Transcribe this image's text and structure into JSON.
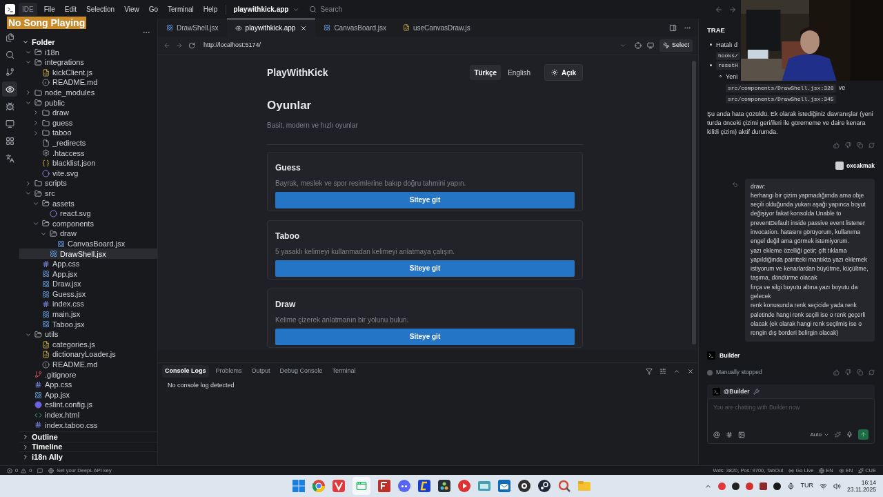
{
  "overlay": {
    "label": "No Song Playing"
  },
  "menu_bar": {
    "app_label": "IDE",
    "menus": [
      "File",
      "Edit",
      "Selection",
      "View",
      "Go",
      "Terminal",
      "Help"
    ],
    "project": "playwithkick.app",
    "search": {
      "placeholder": "Search"
    }
  },
  "activity_bar": [
    {
      "kind": "files",
      "selected": false
    },
    {
      "kind": "search",
      "selected": false
    },
    {
      "kind": "git",
      "selected": false
    },
    {
      "kind": "eye",
      "selected": true
    },
    {
      "kind": "bug",
      "selected": false
    },
    {
      "kind": "monitor",
      "selected": false
    },
    {
      "kind": "grid",
      "selected": false
    },
    {
      "kind": "translate",
      "selected": false
    }
  ],
  "explorer": {
    "section": "Folder",
    "tree": [
      {
        "name": "i18n",
        "kind": "folder",
        "expanded": true
      },
      {
        "name": "integrations",
        "kind": "folder",
        "expanded": true,
        "children": [
          {
            "name": "kickClient.js",
            "kind": "js",
            "selected": false
          },
          {
            "name": "README.md",
            "kind": "info",
            "selected": false
          }
        ]
      },
      {
        "name": "node_modules",
        "kind": "folder",
        "expanded": false
      },
      {
        "name": "public",
        "kind": "folder",
        "expanded": true,
        "children": [
          {
            "name": "draw",
            "kind": "folder",
            "expanded": false
          },
          {
            "name": "guess",
            "kind": "folder",
            "expanded": false
          },
          {
            "name": "taboo",
            "kind": "folder",
            "expanded": false
          },
          {
            "name": "_redirects",
            "kind": "file",
            "selected": false
          },
          {
            "name": ".htaccess",
            "kind": "gear",
            "selected": false
          },
          {
            "name": "blacklist.json",
            "kind": "json",
            "selected": false
          },
          {
            "name": "vite.svg",
            "kind": "svg",
            "selected": false
          }
        ]
      },
      {
        "name": "scripts",
        "kind": "folder",
        "expanded": false
      },
      {
        "name": "src",
        "kind": "folder",
        "expanded": true,
        "children": [
          {
            "name": "assets",
            "kind": "folder",
            "expanded": true,
            "children": [
              {
                "name": "react.svg",
                "kind": "svg",
                "selected": false
              }
            ]
          },
          {
            "name": "components",
            "kind": "folder",
            "expanded": true,
            "children": [
              {
                "name": "draw",
                "kind": "folder",
                "expanded": true,
                "children": [
                  {
                    "name": "CanvasBoard.jsx",
                    "kind": "react",
                    "selected": false
                  }
                ]
              },
              {
                "name": "DrawShell.jsx",
                "kind": "react",
                "selected": true
              }
            ]
          },
          {
            "name": "App.css",
            "kind": "css",
            "selected": false
          },
          {
            "name": "App.jsx",
            "kind": "react",
            "selected": false
          },
          {
            "name": "Draw.jsx",
            "kind": "react",
            "selected": false
          },
          {
            "name": "Guess.jsx",
            "kind": "react",
            "selected": false
          },
          {
            "name": "index.css",
            "kind": "css",
            "selected": false
          },
          {
            "name": "main.jsx",
            "kind": "react",
            "selected": false
          },
          {
            "name": "Taboo.jsx",
            "kind": "react",
            "selected": false
          }
        ]
      },
      {
        "name": "utils",
        "kind": "folder",
        "expanded": true,
        "children": [
          {
            "name": "categories.js",
            "kind": "js",
            "selected": false
          },
          {
            "name": "dictionaryLoader.js",
            "kind": "js",
            "selected": false
          },
          {
            "name": "README.md",
            "kind": "info",
            "selected": false
          }
        ]
      },
      {
        "name": ".gitignore",
        "kind": "git",
        "selected": false
      },
      {
        "name": "App.css",
        "kind": "css",
        "selected": false
      },
      {
        "name": "App.jsx",
        "kind": "react",
        "selected": false
      },
      {
        "name": "eslint.config.js",
        "kind": "eslint",
        "selected": false
      },
      {
        "name": "index.html",
        "kind": "html",
        "selected": false
      },
      {
        "name": "index.taboo.css",
        "kind": "css",
        "selected": false
      }
    ],
    "sections": [
      {
        "label": "Outline",
        "expanded": false
      },
      {
        "label": "Timeline",
        "expanded": false
      },
      {
        "label": "i18n Ally",
        "expanded": false
      }
    ]
  },
  "editor_tabs": [
    {
      "label": "DrawShell.jsx",
      "kind": "react",
      "selected": false
    },
    {
      "label": "playwithkick.app",
      "kind": "eye",
      "selected": true
    },
    {
      "label": "CanvasBoard.jsx",
      "kind": "react",
      "selected": false
    },
    {
      "label": "useCanvasDraw.js",
      "kind": "js",
      "selected": false
    }
  ],
  "browser": {
    "url": "http://localhost:5174/",
    "select_label": "Select"
  },
  "preview": {
    "brand": "PlayWithKick",
    "languages": [
      {
        "label": "Türkçe",
        "selected": true
      },
      {
        "label": "English",
        "selected": false
      }
    ],
    "theme_label": "Açık",
    "title": "Oyunlar",
    "subtitle": "Basit, modern ve hızlı oyunlar",
    "games": [
      {
        "title": "Guess",
        "description": "Bayrak, meslek ve spor resimlerine bakıp doğru tahmini yapın.",
        "button": "Siteye git"
      },
      {
        "title": "Taboo",
        "description": "5 yasaklı kelimeyi kullanmadan kelimeyi anlatmaya çalışın.",
        "button": "Siteye git"
      },
      {
        "title": "Draw",
        "description": "Kelime çizerek anlatmanın bir yolunu bulun.",
        "button": "Siteye git"
      }
    ]
  },
  "panel": {
    "tabs": [
      {
        "label": "Console Logs",
        "selected": true
      },
      {
        "label": "Problems",
        "selected": false
      },
      {
        "label": "Output",
        "selected": false
      },
      {
        "label": "Debug Console",
        "selected": false
      },
      {
        "label": "Terminal",
        "selected": false
      }
    ],
    "message": "No console log detected"
  },
  "chat": {
    "title": "TRAE",
    "bullets": [
      {
        "text": "Hatalı d",
        "code": "hooks/"
      },
      {
        "code": "resetH"
      }
    ],
    "sub_bullet": {
      "text": "Yeni",
      "codes": [
        "src/components/DrawShell.jsx:328",
        "src/components/DrawShell.jsx:345"
      ],
      "joiner": "ve"
    },
    "summary": "Şu anda hata çözüldü. Ek olarak istediğiniz davranışlar (yeni turda önceki çizimi geri/ileri ile görememe ve daire kenara kilitli çizim) aktif durumda.",
    "user": "oxcakmak",
    "user_message": [
      "draw:",
      "herhangi bir çizim yapmadığımda ama obje seçili olduğunda yukarı aşağı yapınca boyut değişiyor fakat konsolda Unable to preventDefault inside passive event listener invocation. hatasını görüyorum, kullanıma engel değil ama görmek istemiyorum.",
      "yazı ekleme özelliği getir; çift tıklama yapıldığında paintteki mantıkta yazı eklemek istiyorum ve kenarlardan büyütme, küçültme, taşıma, döndürme olacak",
      "fırça ve silgi boyutu altına yazı boyutu da gelecek",
      "renk konusunda renk seçicide yada renk paletinde hangi renk seçili ise o renk geçerli olacak (ek olarak hangi renk seçilmiş ise o rengin dış borderi belirgin olacak)"
    ],
    "agent": "Builder",
    "status": "Manually stopped",
    "input": {
      "chip": "@Builder",
      "placeholder": "You are chatting with Builder now",
      "mode": "Auto"
    }
  },
  "status_bar": {
    "errors": "0",
    "warnings": "0",
    "hint": "Set your DeepL API key",
    "right": [
      {
        "kind": "text",
        "label": "Wds: 3820, Pos: 9700, TabOut"
      },
      {
        "kind": "live",
        "label": "Go Live"
      },
      {
        "kind": "globe",
        "label": "EN"
      },
      {
        "kind": "eye",
        "label": "EN"
      },
      {
        "kind": "sparkle",
        "label": "CUE"
      }
    ]
  },
  "taskbar": {
    "language": "TUR",
    "time": "16:14",
    "date": "23.11.2025"
  }
}
